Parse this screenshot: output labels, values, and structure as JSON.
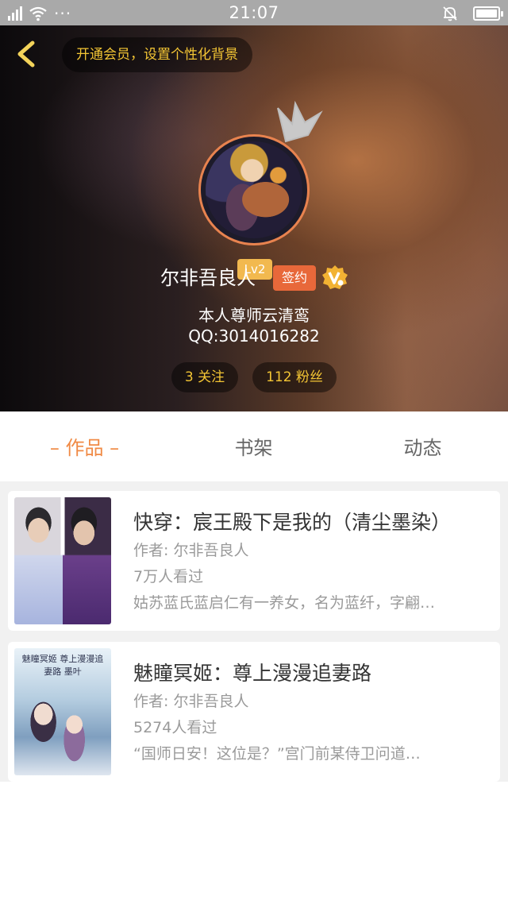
{
  "status_bar": {
    "time": "21:07",
    "icons": [
      "signal-icon",
      "wifi-icon",
      "more-dots-icon",
      "notification-muted-icon",
      "battery-icon"
    ],
    "dots": "···"
  },
  "header": {
    "vip_prompt": "开通会员，设置个性化背景",
    "level": "Lv2",
    "username": "尔非吾良人",
    "signed_badge": "签约",
    "bio": "本人尊师云清鸾",
    "qq": "QQ:3014016282",
    "following": "3 关注",
    "fans": "112 粉丝",
    "colors": {
      "accent": "#f3c534",
      "badge": "#e8683a",
      "ring": "#e8834f"
    }
  },
  "tabs": [
    {
      "label": "– 作品 –",
      "active": true
    },
    {
      "label": "书架",
      "active": false
    },
    {
      "label": "动态",
      "active": false
    }
  ],
  "books": [
    {
      "title": "快穿：宸王殿下是我的（清尘墨染）",
      "author": "作者: 尔非吾良人",
      "views": "7万人看过",
      "description": "姑苏蓝氏蓝启仁有一养女，名为蓝纤，字翩…"
    },
    {
      "title": "魅瞳冥姬：尊上漫漫追妻路",
      "author": "作者: 尔非吾良人",
      "views": "5274人看过",
      "description": "“国师日安！这位是？”宫门前某侍卫问道…",
      "cover_text": "魅瞳冥姬 尊上漫漫追妻路 墨叶"
    }
  ]
}
